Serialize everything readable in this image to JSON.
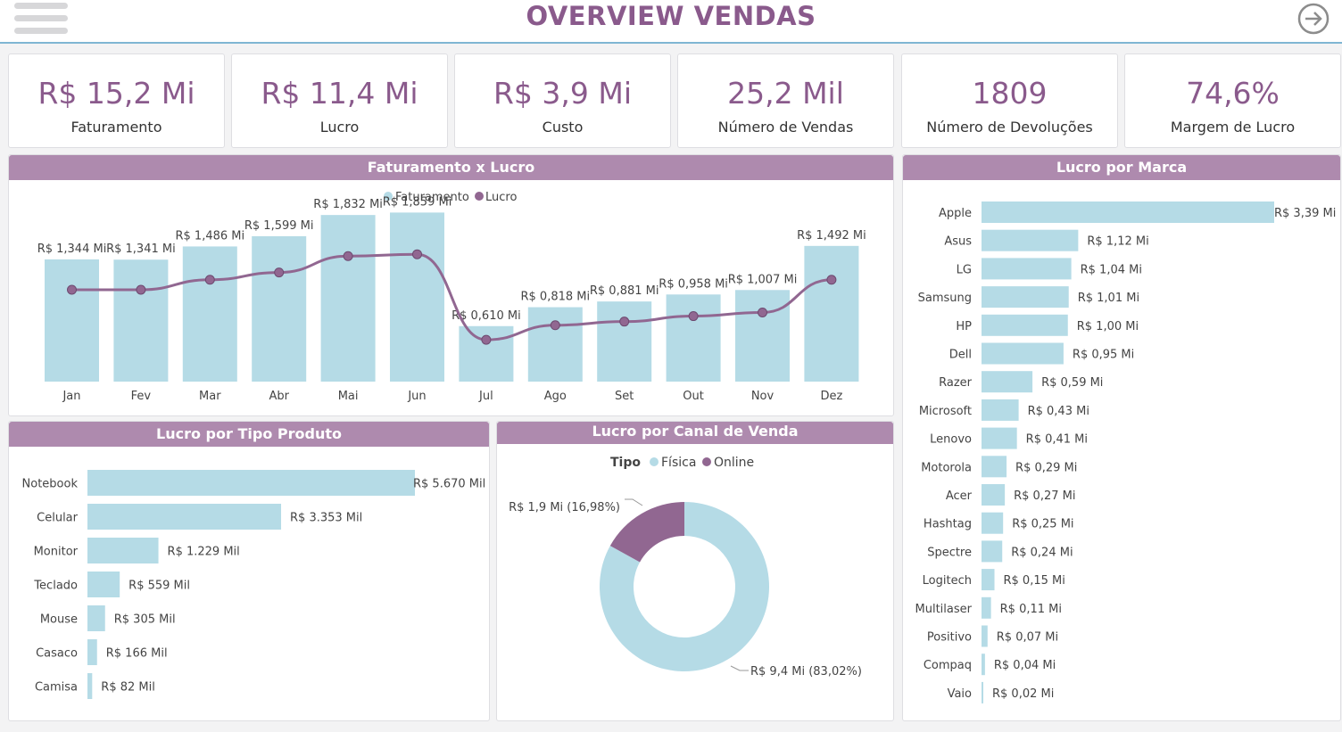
{
  "header": {
    "title": "OVERVIEW VENDAS"
  },
  "kpis": [
    {
      "value": "R$ 15,2 Mi",
      "label": "Faturamento"
    },
    {
      "value": "R$ 11,4 Mi",
      "label": "Lucro"
    },
    {
      "value": "R$ 3,9 Mi",
      "label": "Custo"
    },
    {
      "value": "25,2 Mil",
      "label": "Número de Vendas"
    },
    {
      "value": "1809",
      "label": "Número de Devoluções"
    },
    {
      "value": "74,6%",
      "label": "Margem de Lucro"
    }
  ],
  "colors": {
    "accent": "#8a5a8c",
    "bar": "#b5dbe6",
    "line": "#916791",
    "header": "#ae8aae"
  },
  "monthly": {
    "title": "Faturamento x Lucro",
    "legend": [
      "Faturamento",
      "Lucro"
    ]
  },
  "brands": {
    "title": "Lucro por Marca"
  },
  "product_types": {
    "title": "Lucro por Tipo Produto"
  },
  "channels": {
    "title": "Lucro por Canal de Venda",
    "legend_title": "Tipo",
    "legend": [
      "Física",
      "Online"
    ]
  },
  "chart_data": [
    {
      "type": "bar",
      "title": "Faturamento x Lucro",
      "categories": [
        "Jan",
        "Fev",
        "Mar",
        "Abr",
        "Mai",
        "Jun",
        "Jul",
        "Ago",
        "Set",
        "Out",
        "Nov",
        "Dez"
      ],
      "series": [
        {
          "name": "Faturamento",
          "type": "bar",
          "values": [
            1.344,
            1.341,
            1.486,
            1.599,
            1.832,
            1.859,
            0.61,
            0.818,
            0.881,
            0.958,
            1.007,
            1.492
          ],
          "labels": [
            "R$ 1,344 Mi",
            "R$ 1,341 Mi",
            "R$ 1,486 Mi",
            "R$ 1,599 Mi",
            "R$ 1,832 Mi",
            "R$ 1,859 Mi",
            "R$ 0,610 Mi",
            "R$ 0,818 Mi",
            "R$ 0,881 Mi",
            "R$ 0,958 Mi",
            "R$ 1,007 Mi",
            "R$ 1,492 Mi"
          ]
        },
        {
          "name": "Lucro",
          "type": "line",
          "values": [
            1.01,
            1.01,
            1.12,
            1.2,
            1.38,
            1.4,
            0.46,
            0.62,
            0.66,
            0.72,
            0.76,
            1.12
          ]
        }
      ],
      "ylim": [
        0,
        2.0
      ]
    },
    {
      "type": "bar",
      "orientation": "horizontal",
      "title": "Lucro por Marca",
      "categories": [
        "Apple",
        "Asus",
        "LG",
        "Samsung",
        "HP",
        "Dell",
        "Razer",
        "Microsoft",
        "Lenovo",
        "Motorola",
        "Acer",
        "Hashtag",
        "Spectre",
        "Logitech",
        "Multilaser",
        "Positivo",
        "Compaq",
        "Vaio"
      ],
      "values": [
        3.39,
        1.12,
        1.04,
        1.01,
        1.0,
        0.95,
        0.59,
        0.43,
        0.41,
        0.29,
        0.27,
        0.25,
        0.24,
        0.15,
        0.11,
        0.07,
        0.04,
        0.02
      ],
      "labels": [
        "R$ 3,39 Mi",
        "R$ 1,12 Mi",
        "R$ 1,04 Mi",
        "R$ 1,01 Mi",
        "R$ 1,00 Mi",
        "R$ 0,95 Mi",
        "R$ 0,59 Mi",
        "R$ 0,43 Mi",
        "R$ 0,41 Mi",
        "R$ 0,29 Mi",
        "R$ 0,27 Mi",
        "R$ 0,25 Mi",
        "R$ 0,24 Mi",
        "R$ 0,15 Mi",
        "R$ 0,11 Mi",
        "R$ 0,07 Mi",
        "R$ 0,04 Mi",
        "R$ 0,02 Mi"
      ]
    },
    {
      "type": "bar",
      "orientation": "horizontal",
      "title": "Lucro por Tipo Produto",
      "categories": [
        "Notebook",
        "Celular",
        "Monitor",
        "Teclado",
        "Mouse",
        "Casaco",
        "Camisa"
      ],
      "values": [
        5670,
        3353,
        1229,
        559,
        305,
        166,
        82
      ],
      "labels": [
        "R$ 5.670 Mil",
        "R$ 3.353 Mil",
        "R$ 1.229 Mil",
        "R$ 559 Mil",
        "R$ 305 Mil",
        "R$ 166 Mil",
        "R$ 82 Mil"
      ]
    },
    {
      "type": "pie",
      "variant": "donut",
      "title": "Lucro por Canal de Venda",
      "categories": [
        "Física",
        "Online"
      ],
      "values": [
        83.02,
        16.98
      ],
      "labels": [
        "R$ 9,4 Mi (83,02%)",
        "R$ 1,9 Mi (16,98%)"
      ]
    }
  ]
}
